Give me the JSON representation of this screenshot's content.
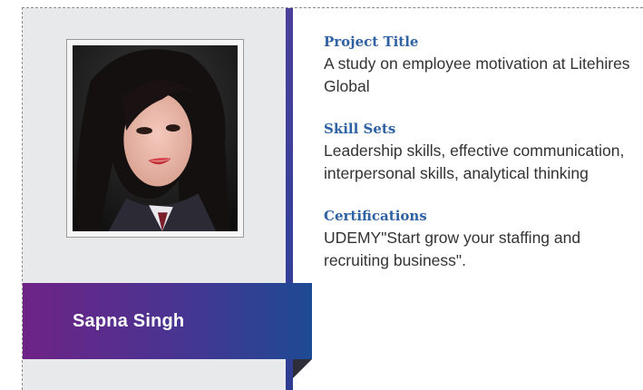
{
  "profile": {
    "name": "Sapna Singh",
    "photo_icon": "profile-photo"
  },
  "sections": [
    {
      "title": "Project Title",
      "body": "A study on employee motivation at Litehires Global"
    },
    {
      "title": "Skill Sets",
      "body": "Leadership skills, effective communication, interpersonal skills, analytical thinking"
    },
    {
      "title": "Certifications",
      "body": "UDEMY\"Start grow your staffing and recruiting business\"."
    }
  ],
  "colors": {
    "heading": "#2f62a3",
    "banner_start": "#6e2386",
    "banner_end": "#1e4a94",
    "panel": "#e8e9ea"
  }
}
